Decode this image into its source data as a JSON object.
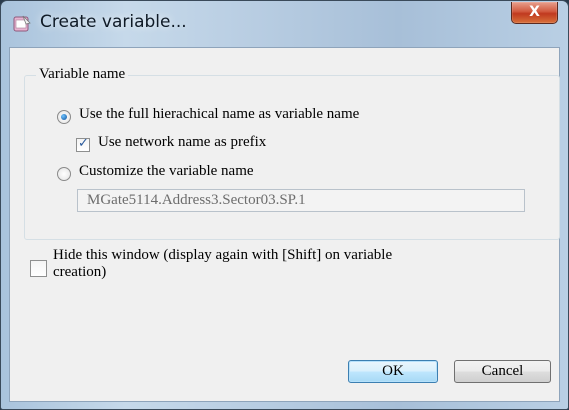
{
  "window": {
    "title": "Create variable...",
    "close_glyph": "X",
    "icon": "app-window-icon"
  },
  "group": {
    "label": "Variable name",
    "option_full_name": {
      "label": "Use the full hierachical name as variable name",
      "selected": true
    },
    "prefix_checkbox": {
      "label": "Use network name as prefix",
      "checked": true
    },
    "option_custom": {
      "label": "Customize the variable name",
      "selected": false
    },
    "custom_field": {
      "value": "MGate5114.Address3.Sector03.SP.1"
    }
  },
  "hide_checkbox": {
    "label_line1": "Hide this window (display again with [Shift] on variable",
    "label_line2": "creation)",
    "checked": false
  },
  "buttons": {
    "ok_label": "OK",
    "cancel_label": "Cancel"
  },
  "colors": {
    "accent": "#0d4f9a",
    "close_button": "#c0391f",
    "dialog_bg": "#f0f0f0"
  }
}
